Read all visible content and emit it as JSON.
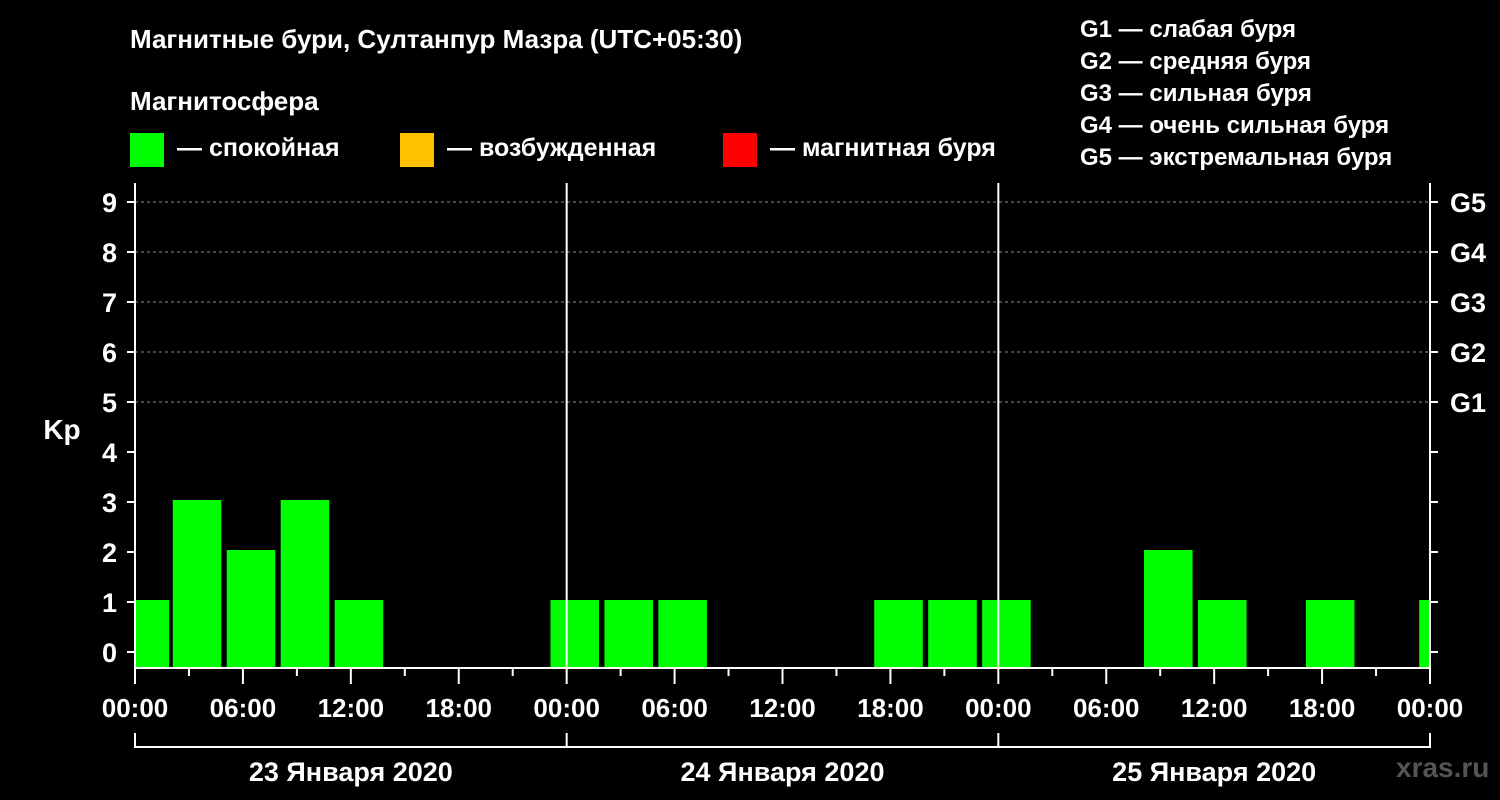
{
  "header": {
    "title": "Магнитные бури, Султанпур Мазра (UTC+05:30)",
    "legend_heading": "Магнитосфера",
    "legend": [
      {
        "color": "#00ff00",
        "label": "— спокойная"
      },
      {
        "color": "#ffc000",
        "label": "— возбужденная"
      },
      {
        "color": "#ff0000",
        "label": "— магнитная буря"
      }
    ],
    "g_levels": [
      "G1 — слабая буря",
      "G2 — средняя буря",
      "G3 — сильная буря",
      "G4 — очень сильная буря",
      "G5 — экстремальная буря"
    ]
  },
  "watermark": "xras.ru",
  "chart_data": {
    "type": "bar",
    "ylabel": "Kp",
    "ylim": [
      0,
      9
    ],
    "yticks": [
      0,
      1,
      2,
      3,
      4,
      5,
      6,
      7,
      8,
      9
    ],
    "right_axis_labels": [
      {
        "kp": 5,
        "label": "G1"
      },
      {
        "kp": 6,
        "label": "G2"
      },
      {
        "kp": 7,
        "label": "G3"
      },
      {
        "kp": 8,
        "label": "G4"
      },
      {
        "kp": 9,
        "label": "G5"
      }
    ],
    "xlim_hours": [
      0,
      72
    ],
    "xtick_labels": [
      "00:00",
      "06:00",
      "12:00",
      "18:00",
      "00:00",
      "06:00",
      "12:00",
      "18:00",
      "00:00",
      "06:00",
      "12:00",
      "18:00",
      "00:00"
    ],
    "days": [
      "23 Января 2020",
      "24 Января 2020",
      "25 Января 2020"
    ],
    "grid": true,
    "bars": [
      {
        "start_hour": 0,
        "end_hour": 1.9,
        "kp": 1,
        "color": "#00ff00"
      },
      {
        "start_hour": 2.1,
        "end_hour": 4.8,
        "kp": 3,
        "color": "#00ff00"
      },
      {
        "start_hour": 5.1,
        "end_hour": 7.8,
        "kp": 2,
        "color": "#00ff00"
      },
      {
        "start_hour": 8.1,
        "end_hour": 10.8,
        "kp": 3,
        "color": "#00ff00"
      },
      {
        "start_hour": 11.1,
        "end_hour": 13.8,
        "kp": 1,
        "color": "#00ff00"
      },
      {
        "start_hour": 23.1,
        "end_hour": 25.8,
        "kp": 1,
        "color": "#00ff00"
      },
      {
        "start_hour": 26.1,
        "end_hour": 28.8,
        "kp": 1,
        "color": "#00ff00"
      },
      {
        "start_hour": 29.1,
        "end_hour": 31.8,
        "kp": 1,
        "color": "#00ff00"
      },
      {
        "start_hour": 41.1,
        "end_hour": 43.8,
        "kp": 1,
        "color": "#00ff00"
      },
      {
        "start_hour": 44.1,
        "end_hour": 46.8,
        "kp": 1,
        "color": "#00ff00"
      },
      {
        "start_hour": 47.1,
        "end_hour": 49.8,
        "kp": 1,
        "color": "#00ff00"
      },
      {
        "start_hour": 56.1,
        "end_hour": 58.8,
        "kp": 2,
        "color": "#00ff00"
      },
      {
        "start_hour": 59.1,
        "end_hour": 61.8,
        "kp": 1,
        "color": "#00ff00"
      },
      {
        "start_hour": 65.1,
        "end_hour": 67.8,
        "kp": 1,
        "color": "#00ff00"
      },
      {
        "start_hour": 71.4,
        "end_hour": 72,
        "kp": 1,
        "color": "#00ff00"
      }
    ]
  }
}
